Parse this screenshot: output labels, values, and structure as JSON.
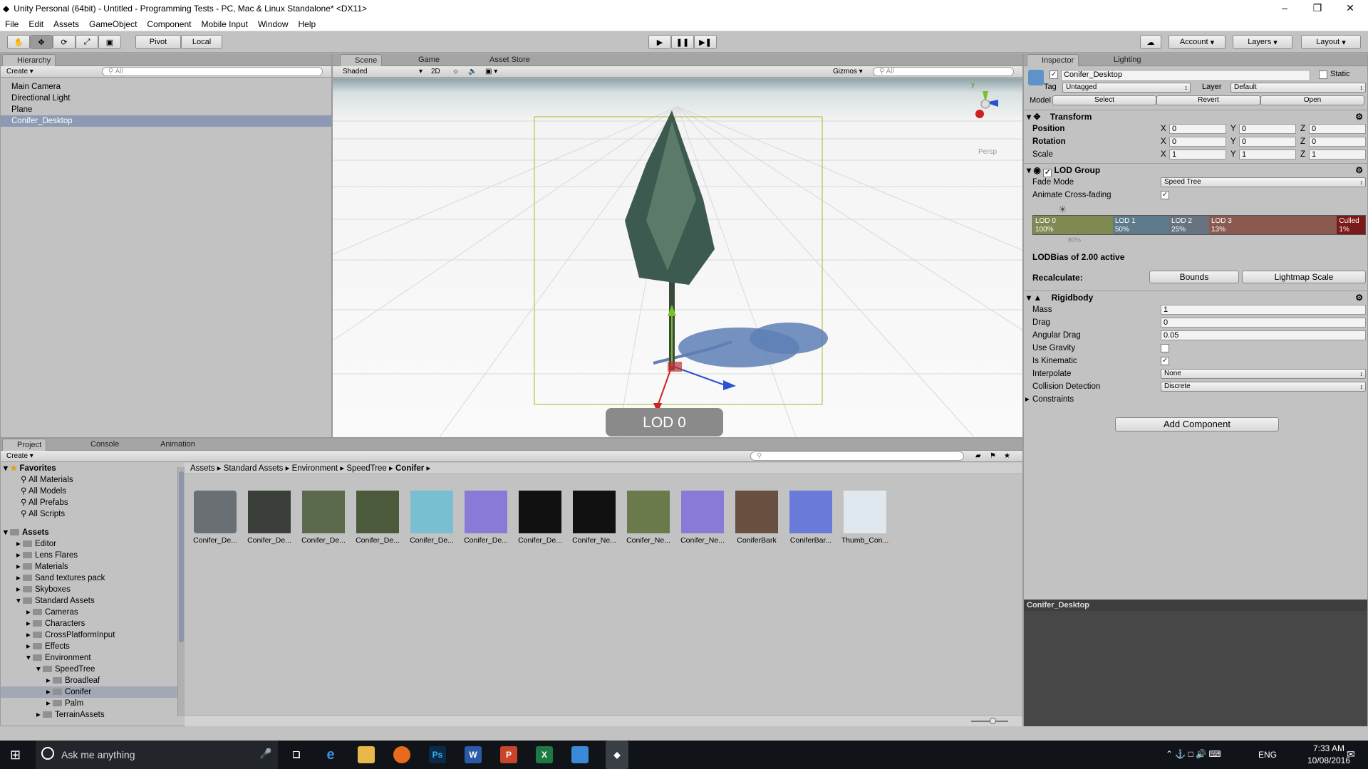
{
  "window": {
    "title": "Unity Personal (64bit) - Untitled - Programming Tests - PC, Mac & Linux Standalone* <DX11>",
    "minimize": "–",
    "maximize": "❐",
    "close": "✕"
  },
  "menu": [
    "File",
    "Edit",
    "Assets",
    "GameObject",
    "Component",
    "Mobile Input",
    "Window",
    "Help"
  ],
  "toolbar": {
    "pivot": "Pivot",
    "local": "Local",
    "account": "Account",
    "layers": "Layers",
    "layout": "Layout"
  },
  "hierarchy": {
    "tab": "Hierarchy",
    "create": "Create",
    "search_placeholder": "All",
    "items": [
      "Main Camera",
      "Directional Light",
      "Plane",
      "Conifer_Desktop"
    ]
  },
  "scene": {
    "tabs": [
      "Scene",
      "Game",
      "Asset Store"
    ],
    "shading": "Shaded",
    "mode2d": "2D",
    "gizmos": "Gizmos",
    "search_placeholder": "All",
    "persp": "Persp",
    "gizmo_y": "y",
    "lod_label": "LOD 0"
  },
  "inspector": {
    "tabs": [
      "Inspector",
      "Lighting"
    ],
    "object_name": "Conifer_Desktop",
    "static": "Static",
    "tag_label": "Tag",
    "tag_value": "Untagged",
    "layer_label": "Layer",
    "layer_value": "Default",
    "model_label": "Model",
    "model_buttons": [
      "Select",
      "Revert",
      "Open"
    ],
    "transform": {
      "title": "Transform",
      "rows": [
        {
          "label": "Position",
          "x": "0",
          "y": "0",
          "z": "0"
        },
        {
          "label": "Rotation",
          "x": "0",
          "y": "0",
          "z": "0"
        },
        {
          "label": "Scale",
          "x": "1",
          "y": "1",
          "z": "1"
        }
      ],
      "axis": [
        "X",
        "Y",
        "Z"
      ]
    },
    "lod_group": {
      "title": "LOD Group",
      "fade_mode_label": "Fade Mode",
      "fade_mode_value": "Speed Tree",
      "cross_fade_label": "Animate Cross-fading",
      "levels": [
        {
          "name": "LOD 0",
          "pct": "100%",
          "color": "#7e8a52"
        },
        {
          "name": "LOD 1",
          "pct": "50%",
          "color": "#5f7a8a"
        },
        {
          "name": "LOD 2",
          "pct": "25%",
          "color": "#677380"
        },
        {
          "name": "LOD 3",
          "pct": "13%",
          "color": "#8a5a50"
        },
        {
          "name": "Culled",
          "pct": "1%",
          "color": "#7a1a1a"
        }
      ],
      "marker": "80%",
      "bias": "LODBias of 2.00 active",
      "recalculate": "Recalculate:",
      "bounds": "Bounds",
      "lightmap": "Lightmap Scale"
    },
    "rigidbody": {
      "title": "Rigidbody",
      "mass_label": "Mass",
      "mass": "1",
      "drag_label": "Drag",
      "drag": "0",
      "angdrag_label": "Angular Drag",
      "angdrag": "0.05",
      "gravity_label": "Use Gravity",
      "kinematic_label": "Is Kinematic",
      "interp_label": "Interpolate",
      "interp": "None",
      "collision_label": "Collision Detection",
      "collision": "Discrete",
      "constraints_label": "Constraints"
    },
    "add_component": "Add Component",
    "preview_title": "Conifer_Desktop"
  },
  "project": {
    "tabs": [
      "Project",
      "Console",
      "Animation"
    ],
    "create": "Create",
    "favorites_label": "Favorites",
    "favorites": [
      "All Materials",
      "All Models",
      "All Prefabs",
      "All Scripts"
    ],
    "assets_label": "Assets",
    "tree": [
      {
        "label": "Editor",
        "level": 1
      },
      {
        "label": "Lens Flares",
        "level": 1
      },
      {
        "label": "Materials",
        "level": 1
      },
      {
        "label": "Sand textures pack",
        "level": 1
      },
      {
        "label": "Skyboxes",
        "level": 1
      },
      {
        "label": "Standard Assets",
        "level": 1
      },
      {
        "label": "Cameras",
        "level": 2
      },
      {
        "label": "Characters",
        "level": 2
      },
      {
        "label": "CrossPlatformInput",
        "level": 2
      },
      {
        "label": "Effects",
        "level": 2
      },
      {
        "label": "Environment",
        "level": 2
      },
      {
        "label": "SpeedTree",
        "level": 3
      },
      {
        "label": "Broadleaf",
        "level": 4
      },
      {
        "label": "Conifer",
        "level": 4
      },
      {
        "label": "Palm",
        "level": 4
      },
      {
        "label": "TerrainAssets",
        "level": 3
      }
    ],
    "breadcrumb": [
      "Assets",
      "Standard Assets",
      "Environment",
      "SpeedTree",
      "Conifer"
    ],
    "assets": [
      "Conifer_De...",
      "Conifer_De...",
      "Conifer_De...",
      "Conifer_De...",
      "Conifer_De...",
      "Conifer_De...",
      "Conifer_De...",
      "Conifer_Ne...",
      "Conifer_Ne...",
      "Conifer_Ne...",
      "ConiferBark",
      "ConiferBar...",
      "Thumb_Con..."
    ]
  },
  "taskbar": {
    "search": "Ask me anything",
    "lang": "ENG",
    "time": "7:33 AM",
    "date": "10/08/2016"
  }
}
